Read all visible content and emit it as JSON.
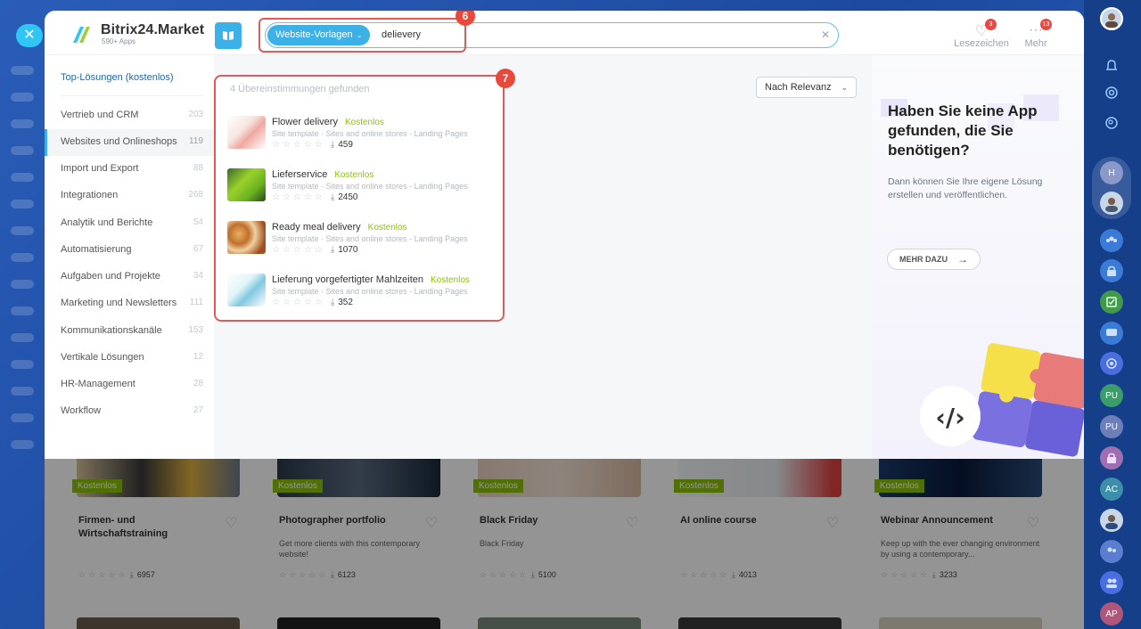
{
  "header": {
    "logo_title": "Bitrix24.Market",
    "logo_sub": "590+ Apps",
    "search_chip": "Website-Vorlagen",
    "search_value": "delievery",
    "bookmarks_label": "Lesezeichen",
    "bookmarks_count": "3",
    "more_label": "Mehr",
    "more_count": "13",
    "callout_6": "6",
    "callout_7": "7"
  },
  "nav": {
    "top": "Top-Lösungen (kostenlos)",
    "items": [
      {
        "label": "Vertrieb und CRM",
        "count": "203"
      },
      {
        "label": "Websites und Onlineshops",
        "count": "119"
      },
      {
        "label": "Import und Export",
        "count": "88"
      },
      {
        "label": "Integrationen",
        "count": "268"
      },
      {
        "label": "Analytik und Berichte",
        "count": "54"
      },
      {
        "label": "Automatisierung",
        "count": "67"
      },
      {
        "label": "Aufgaben und Projekte",
        "count": "34"
      },
      {
        "label": "Marketing und Newsletters",
        "count": "111"
      },
      {
        "label": "Kommunikationskanäle",
        "count": "153"
      },
      {
        "label": "Vertikale Lösungen",
        "count": "12"
      },
      {
        "label": "HR-Management",
        "count": "28"
      },
      {
        "label": "Workflow",
        "count": "27"
      }
    ]
  },
  "results": {
    "count_text": "4 Übereinstimmungen gefunden",
    "sort_label": "Nach Relevanz",
    "items": [
      {
        "title": "Flower delivery",
        "price": "Kostenlos",
        "desc": "Site template · Sites and online stores - Landing Pages",
        "stars": "☆☆☆☆☆",
        "downloads": "459"
      },
      {
        "title": "Lieferservice",
        "price": "Kostenlos",
        "desc": "Site template · Sites and online stores - Landing Pages",
        "stars": "☆☆☆☆☆",
        "downloads": "2450"
      },
      {
        "title": "Ready meal delivery",
        "price": "Kostenlos",
        "desc": "Site template · Sites and online stores - Landing Pages",
        "stars": "☆☆☆☆☆",
        "downloads": "1070"
      },
      {
        "title": "Lieferung vorgefertigter Mahlzeiten",
        "price": "Kostenlos",
        "desc": "Site template · Sites and online stores - Landing Pages",
        "stars": "☆☆☆☆☆",
        "downloads": "352"
      }
    ]
  },
  "promo": {
    "title": "Haben Sie keine App gefunden, die Sie benötigen?",
    "text": "Dann können Sie Ihre eigene Lösung erstellen und veröffentlichen.",
    "button": "MEHR DAZU"
  },
  "cards": [
    {
      "tag": "Kostenlos",
      "title": "Firmen- und Wirtschaftstraining",
      "desc": "",
      "downloads": "6957"
    },
    {
      "tag": "Kostenlos",
      "title": "Photographer portfolio",
      "desc": "Get more clients with this contemporary website!",
      "downloads": "6123"
    },
    {
      "tag": "Kostenlos",
      "title": "Black Friday",
      "desc": "Black Friday",
      "downloads": "5100"
    },
    {
      "tag": "Kostenlos",
      "title": "AI online course",
      "desc": "",
      "downloads": "4013"
    },
    {
      "tag": "Kostenlos",
      "title": "Webinar Announcement",
      "desc": "Keep up with the ever changing environment by using a contemporary...",
      "downloads": "3233"
    }
  ],
  "right_bar": {
    "items": [
      "H",
      "PU",
      "PU",
      "AC",
      "AP"
    ]
  },
  "colors": {
    "accent": "#3bb1e8",
    "free_green": "#8bc20c",
    "callout_red": "#e9493a"
  }
}
